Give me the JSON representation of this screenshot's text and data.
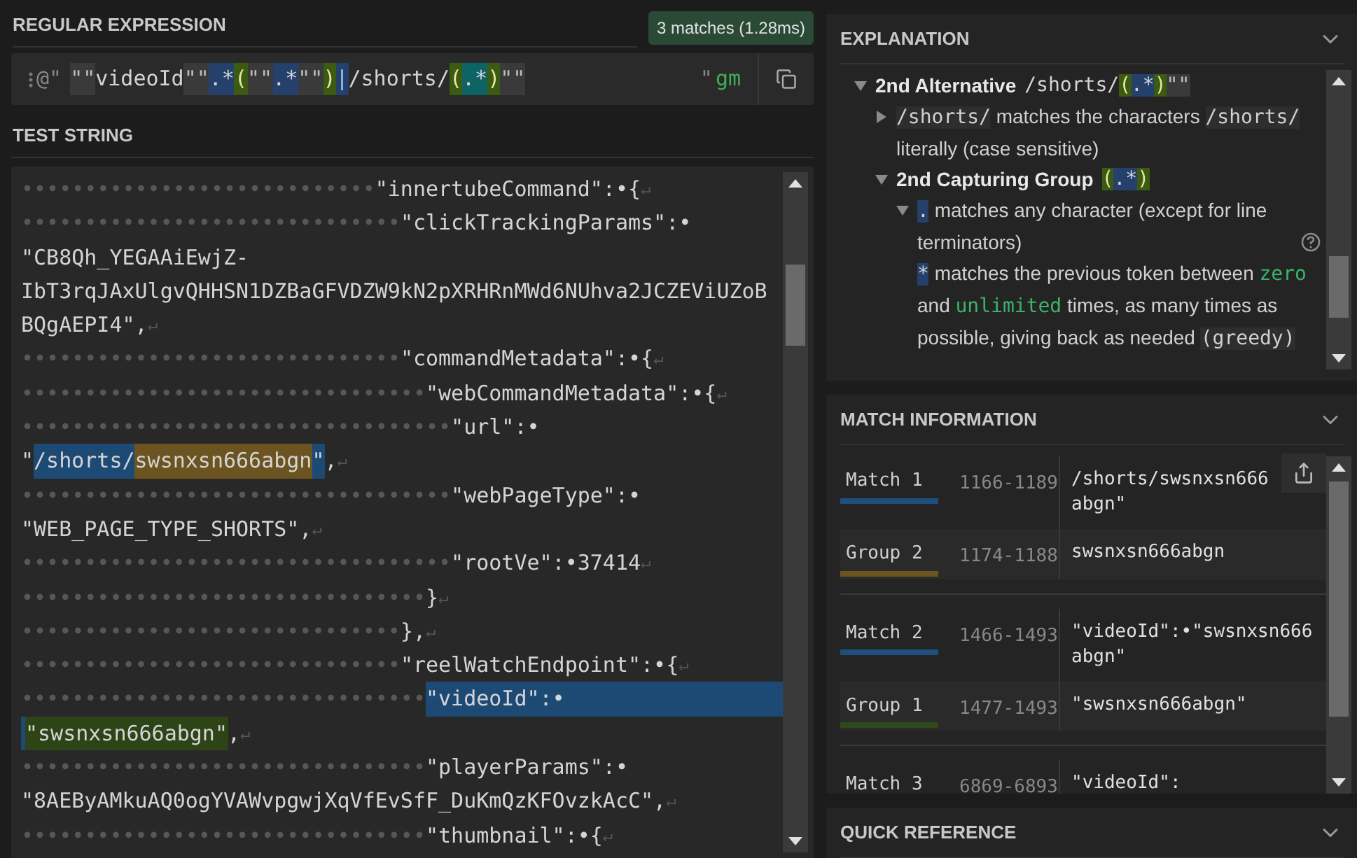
{
  "regex_panel": {
    "title": "REGULAR EXPRESSION",
    "match_badge": "3 matches (1.28ms)",
    "prefix": "@\"",
    "tokens": [
      {
        "kind": "escape",
        "text": "\"\""
      },
      {
        "kind": "plain",
        "text": "videoId"
      },
      {
        "kind": "escape",
        "text": "\"\""
      },
      {
        "kind": "meta",
        "text": ".*"
      },
      {
        "kind": "group",
        "text": "("
      },
      {
        "kind": "escape",
        "text": "\"\""
      },
      {
        "kind": "meta",
        "text": ".*"
      },
      {
        "kind": "escape",
        "text": "\"\""
      },
      {
        "kind": "group",
        "text": ")"
      },
      {
        "kind": "alt",
        "text": "|"
      },
      {
        "kind": "plain",
        "text": "/shorts/"
      },
      {
        "kind": "group",
        "text": "("
      },
      {
        "kind": "active",
        "text": ".*"
      },
      {
        "kind": "group",
        "text": ")"
      },
      {
        "kind": "escape",
        "text": "\"\""
      }
    ],
    "suffix": "\"",
    "flags": "gm"
  },
  "test_string": {
    "title": "TEST STRING",
    "lines": [
      {
        "indent": "••••••••••••••••••••••••••••",
        "segments": [
          {
            "kind": "plain",
            "text": "\"innertubeCommand\":•{"
          }
        ],
        "eol": "↵"
      },
      {
        "indent": "••••••••••••••••••••••••••••••",
        "segments": [
          {
            "kind": "plain",
            "text": "\"clickTrackingParams\":•"
          }
        ]
      },
      {
        "segments": [
          {
            "kind": "plain",
            "text": "\"CB8Qh_YEGAAiEwjZ-"
          }
        ]
      },
      {
        "segments": [
          {
            "kind": "plain",
            "text": "IbT3rqJAxUlgvQHHSN1DZBaGFVDZW9kN2pXRHRnMWd6NUhva2JCZEViUZoB"
          }
        ]
      },
      {
        "segments": [
          {
            "kind": "plain",
            "text": "BQgAEPI4\","
          }
        ],
        "eol": "↵"
      },
      {
        "indent": "••••••••••••••••••••••••••••••",
        "segments": [
          {
            "kind": "plain",
            "text": "\"commandMetadata\":•{"
          }
        ],
        "eol": "↵"
      },
      {
        "indent": "••••••••••••••••••••••••••••••••",
        "segments": [
          {
            "kind": "plain",
            "text": "\"webCommandMetadata\":•{"
          }
        ],
        "eol": "↵"
      },
      {
        "indent": "••••••••••••••••••••••••••••••••••",
        "segments": [
          {
            "kind": "plain",
            "text": "\"url\":•"
          }
        ]
      },
      {
        "segments": [
          {
            "kind": "plain",
            "text": "\""
          },
          {
            "kind": "match",
            "text": "/shorts/"
          },
          {
            "kind": "group2",
            "text": "swsnxsn666abgn"
          },
          {
            "kind": "match",
            "text": "\""
          },
          {
            "kind": "plain",
            "text": ","
          }
        ],
        "eol": "↵"
      },
      {
        "indent": "••••••••••••••••••••••••••••••••••",
        "segments": [
          {
            "kind": "plain",
            "text": "\"webPageType\":•"
          }
        ]
      },
      {
        "segments": [
          {
            "kind": "plain",
            "text": "\"WEB_PAGE_TYPE_SHORTS\","
          }
        ],
        "eol": "↵"
      },
      {
        "indent": "••••••••••••••••••••••••••••••••••",
        "segments": [
          {
            "kind": "plain",
            "text": "\"rootVe\":•37414"
          }
        ],
        "eol": "↵"
      },
      {
        "indent": "••••••••••••••••••••••••••••••••",
        "segments": [
          {
            "kind": "plain",
            "text": "}"
          }
        ],
        "eol": "↵"
      },
      {
        "indent": "••••••••••••••••••••••••••••••",
        "segments": [
          {
            "kind": "plain",
            "text": "},"
          }
        ],
        "eol": "↵"
      },
      {
        "indent": "••••••••••••••••••••••••••••••",
        "segments": [
          {
            "kind": "plain",
            "text": "\"reelWatchEndpoint\":•{"
          }
        ],
        "eol": "↵"
      },
      {
        "indent": "••••••••••••••••••••••••••••••••",
        "segments": [
          {
            "kind": "match",
            "text": "\"videoId\":•"
          }
        ],
        "match_runs_on": true
      },
      {
        "match_continued": true,
        "segments": [
          {
            "kind": "group1",
            "text": "\"swsnxsn666abgn\""
          },
          {
            "kind": "plain",
            "text": ","
          }
        ],
        "eol": "↵"
      },
      {
        "indent": "••••••••••••••••••••••••••••••••",
        "segments": [
          {
            "kind": "plain",
            "text": "\"playerParams\":•"
          }
        ]
      },
      {
        "segments": [
          {
            "kind": "plain",
            "text": "\"8AEByAMkuAQ0ogYVAWvpgwjXqVfEvSfF_DuKmQzKFOvzkAcC\","
          }
        ],
        "eol": "↵"
      },
      {
        "indent": "••••••••••••••••••••••••••••••••",
        "segments": [
          {
            "kind": "plain",
            "text": "\"thumbnail\":•{"
          }
        ],
        "eol": "↵"
      }
    ]
  },
  "explanation": {
    "title": "EXPLANATION",
    "items": [
      {
        "expanded": true,
        "title": "2nd Alternative",
        "tokens": [
          {
            "kind": "plain",
            "text": "/shorts/"
          },
          {
            "kind": "group",
            "text": "("
          },
          {
            "kind": "meta",
            "text": ".*"
          },
          {
            "kind": "group",
            "text": ")"
          },
          {
            "kind": "escape",
            "text": "\"\""
          }
        ],
        "children": [
          {
            "expanded": false,
            "segments": [
              {
                "kind": "code",
                "text": "/shorts/"
              },
              {
                "kind": "text",
                "text": " matches the characters "
              },
              {
                "kind": "code",
                "text": "/shorts/"
              },
              {
                "kind": "text",
                "text": " literally (case sensitive)"
              }
            ]
          },
          {
            "expanded": true,
            "title": "2nd Capturing Group",
            "tokens": [
              {
                "kind": "group",
                "text": "("
              },
              {
                "kind": "meta",
                "text": ".*"
              },
              {
                "kind": "group",
                "text": ")"
              }
            ],
            "children": [
              {
                "expanded": true,
                "help": true,
                "segments": [
                  {
                    "kind": "meta",
                    "text": "."
                  },
                  {
                    "kind": "text",
                    "text": " matches any character (except for line terminators)"
                  }
                ]
              },
              {
                "segments": [
                  {
                    "kind": "meta",
                    "text": "*"
                  },
                  {
                    "kind": "text",
                    "text": " matches the previous token between "
                  },
                  {
                    "kind": "keyword",
                    "text": "zero"
                  },
                  {
                    "kind": "text",
                    "text": " and "
                  },
                  {
                    "kind": "keyword",
                    "text": "unlimited"
                  },
                  {
                    "kind": "text",
                    "text": " times, as many times as possible, giving back as needed "
                  },
                  {
                    "kind": "code",
                    "text": "(greedy)"
                  }
                ]
              }
            ]
          }
        ]
      }
    ]
  },
  "match_information": {
    "title": "MATCH INFORMATION",
    "groups": [
      [
        {
          "kind": "match",
          "label": "Match 1",
          "range": "1166-1189",
          "value": "/shorts/swsnxsn666abgn\"",
          "color": "#1f4f7f"
        },
        {
          "kind": "group",
          "label": "Group 2",
          "range": "1174-1188",
          "value": "swsnxsn666abgn",
          "color": "#6b5420"
        }
      ],
      [
        {
          "kind": "match",
          "label": "Match 2",
          "range": "1466-1493",
          "value": "\"videoId\":•\"swsnxsn666abgn\"",
          "color": "#1f4f7f"
        },
        {
          "kind": "group",
          "label": "Group 1",
          "range": "1477-1493",
          "value": "\"swsnxsn666abgn\"",
          "color": "#2f4a1a"
        }
      ],
      [
        {
          "kind": "match",
          "label": "Match 3",
          "range": "6869-6893",
          "value": "\"videoId\":"
        }
      ]
    ]
  },
  "quick_reference": {
    "title": "QUICK REFERENCE"
  }
}
